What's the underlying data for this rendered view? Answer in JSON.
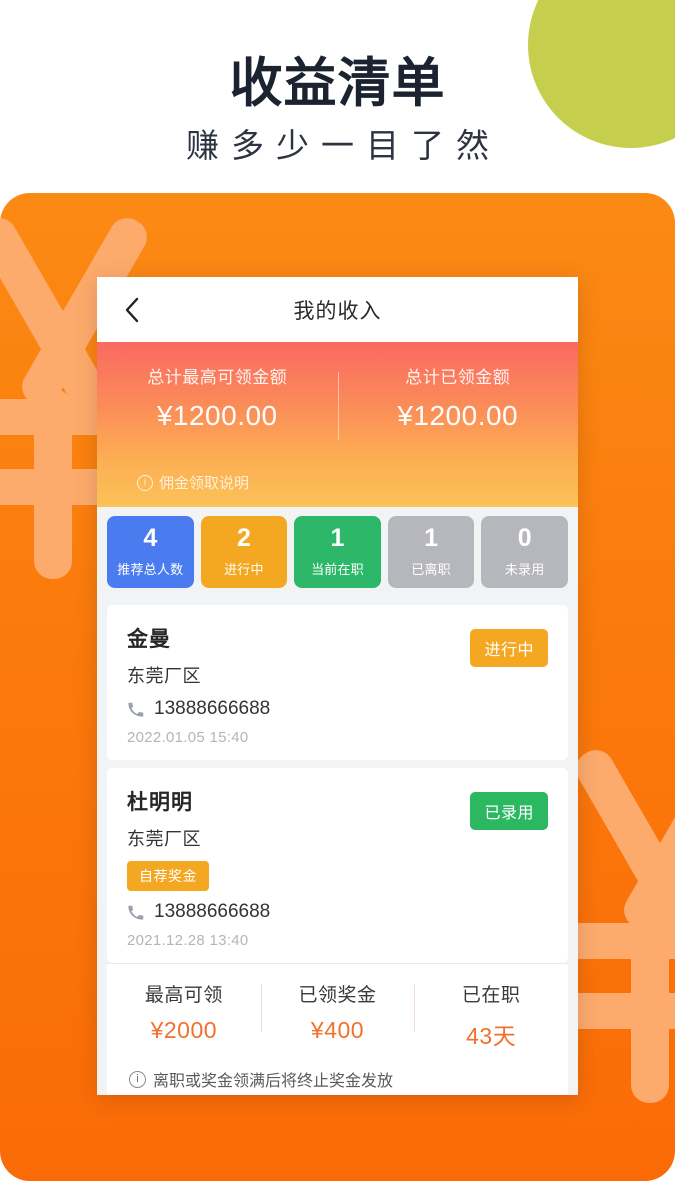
{
  "header": {
    "title": "收益清单",
    "subtitle": "赚多少一目了然"
  },
  "phone": {
    "navbar": {
      "back_icon": "chevron-left-icon",
      "title": "我的收入"
    },
    "summary": {
      "stats": [
        {
          "label": "总计最高可领金额",
          "value": "¥1200.00"
        },
        {
          "label": "总计已领金额",
          "value": "¥1200.00"
        }
      ],
      "note": "佣金领取说明",
      "note_icon": "info-circle-icon"
    },
    "tiles": [
      {
        "number": "4",
        "label": "推荐总人数",
        "color": "#4a7bef"
      },
      {
        "number": "2",
        "label": "进行中",
        "color": "#f4a721"
      },
      {
        "number": "1",
        "label": "当前在职",
        "color": "#2cb868"
      },
      {
        "number": "1",
        "label": "已离职",
        "color": "#b6b6bd"
      },
      {
        "number": "0",
        "label": "未录用",
        "color": "#b6b6bd"
      }
    ],
    "cards": [
      {
        "name": "金曼",
        "region": "东莞厂区",
        "tag": null,
        "phone": "13888666688",
        "phone_icon": "phone-handset-icon",
        "time": "2022.01.05  15:40",
        "badge": "进行中",
        "badge_color": "#f4a721"
      },
      {
        "name": "杜明明",
        "region": "东莞厂区",
        "tag": "自荐奖金",
        "phone": "13888666688",
        "phone_icon": "phone-handset-icon",
        "time": "2021.12.28  13:40",
        "badge": "已录用",
        "badge_color": "#2cb861"
      }
    ],
    "bonus": {
      "items": [
        {
          "label": "最高可领",
          "value": "¥2000"
        },
        {
          "label": "已领奖金",
          "value": "¥400"
        },
        {
          "label": "已在职",
          "value": "43天"
        }
      ],
      "note": "离职或奖金领满后将终止奖金发放",
      "note_icon": "info-circle-icon"
    }
  },
  "decor": {
    "circle_color": "#c5cf4d",
    "stage_color": "#fb7a0c",
    "yen_symbol_color": "#fdab6c"
  }
}
